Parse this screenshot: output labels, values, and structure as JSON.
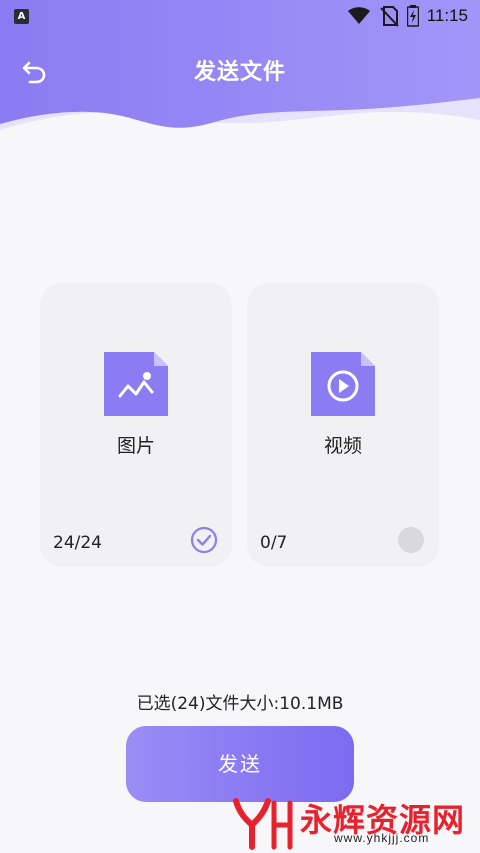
{
  "status_bar": {
    "app_icon_letter": "A",
    "time": "11:15",
    "icons": [
      "wifi-icon",
      "no-sim-icon",
      "battery-charging-icon"
    ]
  },
  "header": {
    "title": "发送文件",
    "back_icon": "back-arrow-icon",
    "accent_start": "#8d7df3",
    "accent_end": "#a89bfa"
  },
  "categories": [
    {
      "label": "图片",
      "count": "24/24",
      "icon": "image-file-icon",
      "selected": true
    },
    {
      "label": "视频",
      "count": "0/7",
      "icon": "video-file-icon",
      "selected": false
    }
  ],
  "summary": "已选(24)文件大小:10.1MB",
  "send_button": {
    "label": "发送"
  },
  "watermark": {
    "name": "永辉资源网",
    "url": "www.yhkjjj.com",
    "color": "#e8222d"
  }
}
